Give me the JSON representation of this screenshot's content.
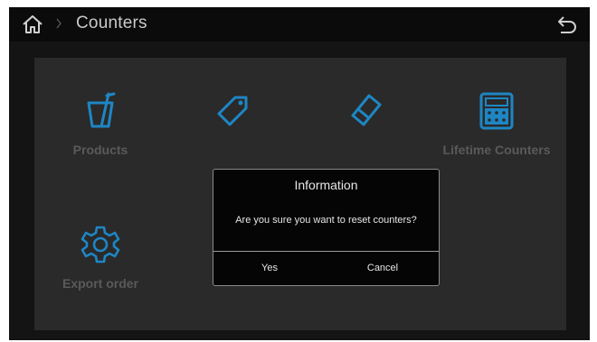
{
  "header": {
    "title": "Counters",
    "home_icon": "home-icon",
    "back_icon": "back-arrow-icon"
  },
  "tiles": [
    {
      "label": "Products",
      "icon": "cup-icon"
    },
    {
      "label": "",
      "icon": "tag-icon"
    },
    {
      "label": "",
      "icon": "eraser-icon"
    },
    {
      "label": "Lifetime Counters",
      "icon": "calculator-icon"
    },
    {
      "label": "Export order",
      "icon": "gear-icon"
    }
  ],
  "dialog": {
    "title": "Information",
    "message": "Are you sure you want to reset counters?",
    "yes_label": "Yes",
    "cancel_label": "Cancel"
  },
  "colors": {
    "accent": "#1e86c4",
    "background": "#141414",
    "panel": "#2a2a2a",
    "dialog": "#050505"
  }
}
